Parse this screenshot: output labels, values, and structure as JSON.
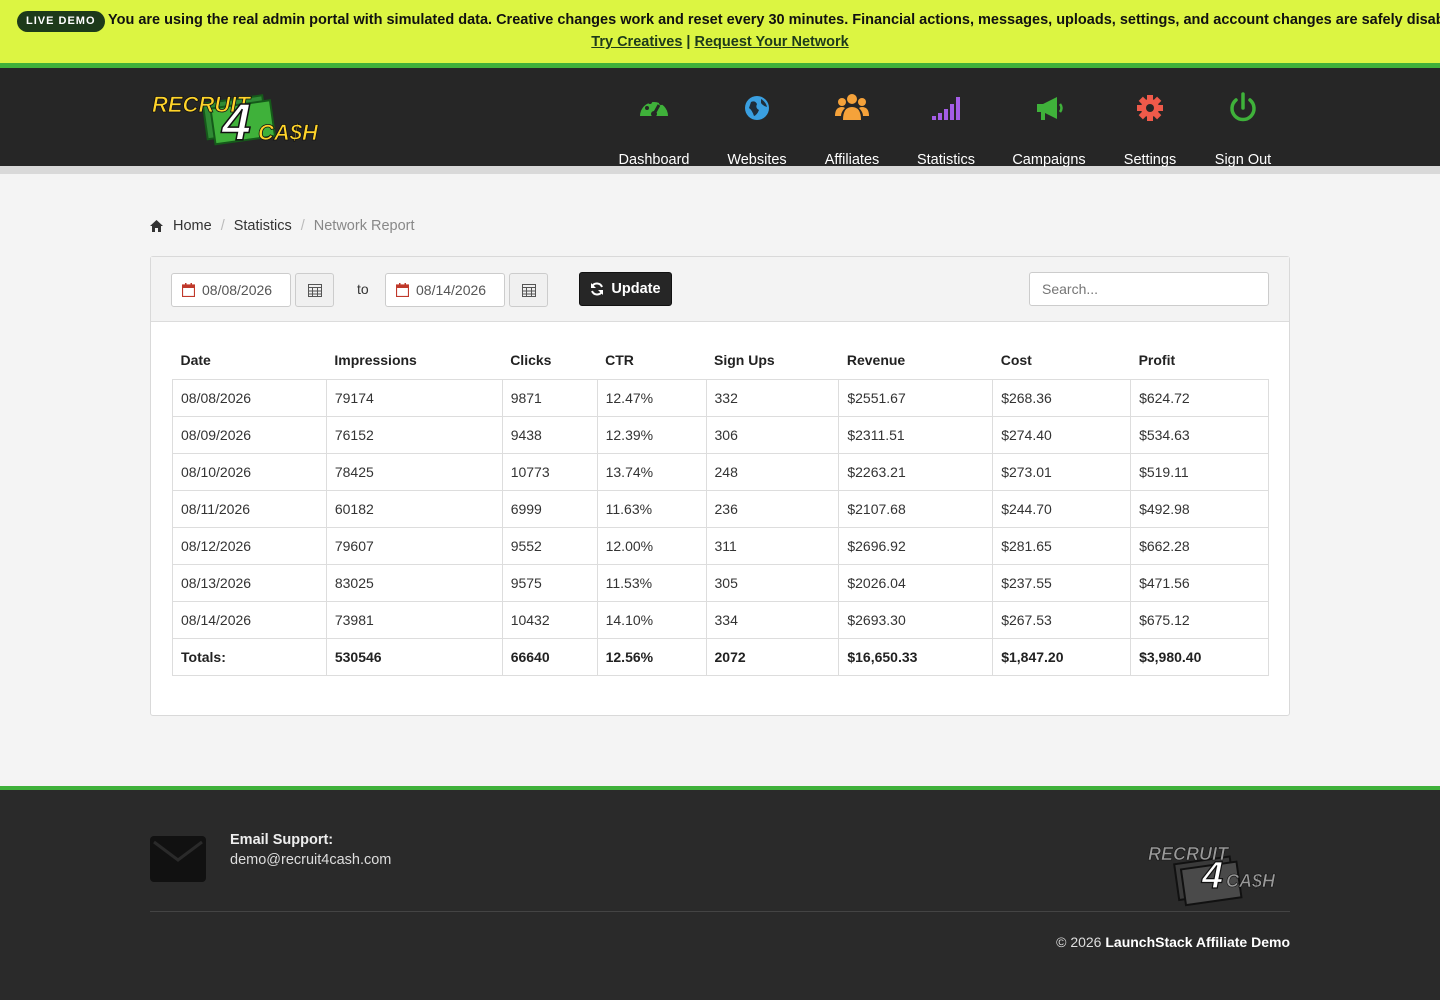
{
  "banner": {
    "badge": "LIVE DEMO",
    "message": "You are using the real admin portal with simulated data. Creative changes work and reset every 30 minutes. Financial actions, messages, uploads, settings, and account changes are safely disabled.",
    "link_try": "Try Creatives",
    "link_separator": "|",
    "link_request": "Request Your Network"
  },
  "brand": {
    "logo_top": "RECRUIT",
    "logo_num": "4",
    "logo_bottom": "CA$H"
  },
  "nav": [
    {
      "label": "Dashboard",
      "icon": "dashboard-gauge-icon",
      "color": "#3fb13a"
    },
    {
      "label": "Websites",
      "icon": "globe-icon",
      "color": "#3a9fe0"
    },
    {
      "label": "Affiliates",
      "icon": "users-icon",
      "color": "#f5a23a"
    },
    {
      "label": "Statistics",
      "icon": "signal-bars-icon",
      "color": "#a45de6"
    },
    {
      "label": "Campaigns",
      "icon": "megaphone-icon",
      "color": "#3fb13a"
    },
    {
      "label": "Settings",
      "icon": "gear-icon",
      "color": "#ef5a4a"
    },
    {
      "label": "Sign Out",
      "icon": "power-icon",
      "color": "#3fb13a"
    }
  ],
  "breadcrumb": {
    "home": "Home",
    "statistics": "Statistics",
    "current": "Network Report",
    "separator": "/"
  },
  "filters": {
    "start_date": "08/08/2026",
    "to_label": "to",
    "end_date": "08/14/2026",
    "update_label": "Update",
    "search_placeholder": "Search..."
  },
  "table": {
    "columns": [
      "Date",
      "Impressions",
      "Clicks",
      "CTR",
      "Sign Ups",
      "Revenue",
      "Cost",
      "Profit"
    ],
    "rows": [
      [
        "08/08/2026",
        "79174",
        "9871",
        "12.47%",
        "332",
        "$2551.67",
        "$268.36",
        "$624.72"
      ],
      [
        "08/09/2026",
        "76152",
        "9438",
        "12.39%",
        "306",
        "$2311.51",
        "$274.40",
        "$534.63"
      ],
      [
        "08/10/2026",
        "78425",
        "10773",
        "13.74%",
        "248",
        "$2263.21",
        "$273.01",
        "$519.11"
      ],
      [
        "08/11/2026",
        "60182",
        "6999",
        "11.63%",
        "236",
        "$2107.68",
        "$244.70",
        "$492.98"
      ],
      [
        "08/12/2026",
        "79607",
        "9552",
        "12.00%",
        "311",
        "$2696.92",
        "$281.65",
        "$662.28"
      ],
      [
        "08/13/2026",
        "83025",
        "9575",
        "11.53%",
        "305",
        "$2026.04",
        "$237.55",
        "$471.56"
      ],
      [
        "08/14/2026",
        "73981",
        "10432",
        "14.10%",
        "334",
        "$2693.30",
        "$267.53",
        "$675.12"
      ]
    ],
    "totals": [
      "Totals:",
      "530546",
      "66640",
      "12.56%",
      "2072",
      "$16,650.33",
      "$1,847.20",
      "$3,980.40"
    ]
  },
  "footer": {
    "support_title": "Email Support:",
    "support_email": "demo@recruit4cash.com",
    "copyright_prefix": "© 2026",
    "copyright_brand": "LaunchStack Affiliate Demo"
  },
  "colors": {
    "banner_bg": "#dcf542",
    "accent_green": "#3fb13a",
    "header_bg": "#262626"
  }
}
